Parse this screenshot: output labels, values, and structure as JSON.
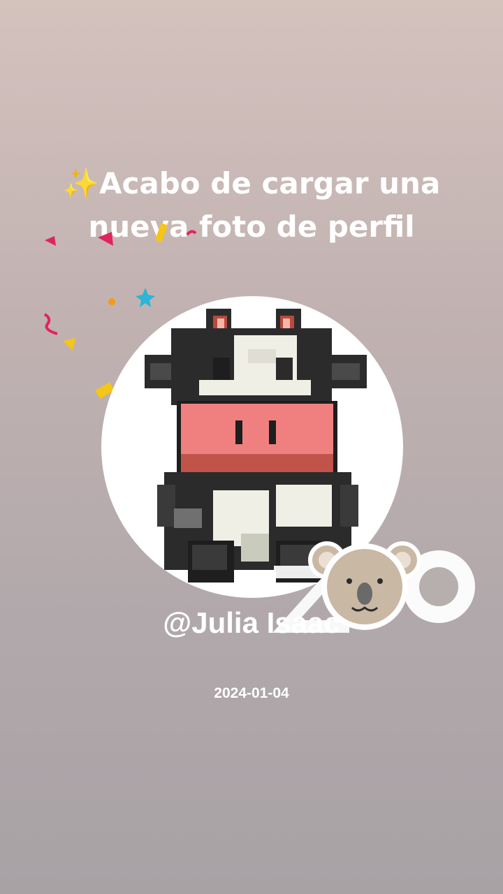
{
  "post": {
    "sparkle_icon": "sparkles-emoji",
    "headline_line1": "Acabo de cargar una",
    "headline_line2": "nueva foto de perfil",
    "username": "@Julia Isaac",
    "date": "2024-01-04"
  },
  "avatar": {
    "icon": "pixel-cow-avatar"
  },
  "watermark": {
    "icon": "zoo-koala-logo",
    "text": "ZOO"
  },
  "colors": {
    "headline_text": "#ffffff",
    "background_top": "#d4c2bd",
    "background_bottom": "#a8a2a5",
    "cow_nose": "#f08080",
    "confetti": [
      "#e0245e",
      "#f5c518",
      "#29b6d8",
      "#f39c12"
    ]
  }
}
